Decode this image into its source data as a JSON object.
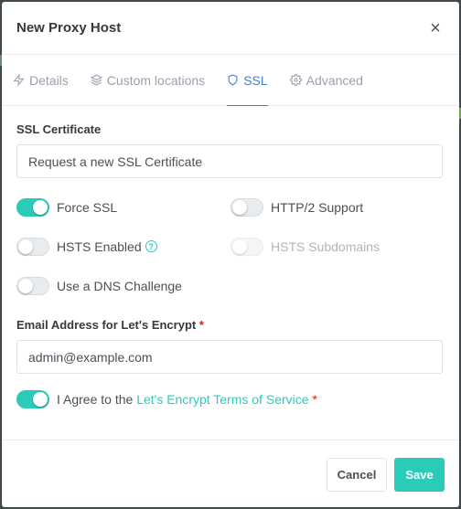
{
  "modal": {
    "title": "New Proxy Host",
    "close_glyph": "×"
  },
  "tabs": [
    {
      "label": "Details",
      "icon": "lightning-icon",
      "active": false
    },
    {
      "label": "Custom locations",
      "icon": "layers-icon",
      "active": false
    },
    {
      "label": "SSL",
      "icon": "shield-icon",
      "active": true
    },
    {
      "label": "Advanced",
      "icon": "gear-icon",
      "active": false
    }
  ],
  "ssl": {
    "certificate_label": "SSL Certificate",
    "certificate_value": "Request a new SSL Certificate",
    "force_ssl": {
      "label": "Force SSL",
      "on": true
    },
    "http2": {
      "label": "HTTP/2 Support",
      "on": false
    },
    "hsts": {
      "label": "HSTS Enabled",
      "on": false,
      "help_glyph": "?"
    },
    "hsts_sub": {
      "label": "HSTS Subdomains",
      "on": false,
      "disabled": true
    },
    "dns_challenge": {
      "label": "Use a DNS Challenge",
      "on": false
    },
    "email_label": "Email Address for Let's Encrypt",
    "required_mark": "*",
    "email_value": "admin@example.com",
    "agree_prefix": "I Agree to the",
    "agree_link": "Let's Encrypt Terms of Service",
    "agree_on": true
  },
  "footer": {
    "cancel_label": "Cancel",
    "save_label": "Save"
  },
  "colors": {
    "accent": "#2bcbba",
    "tab_active": "#467fcf",
    "required": "#cd201f"
  }
}
